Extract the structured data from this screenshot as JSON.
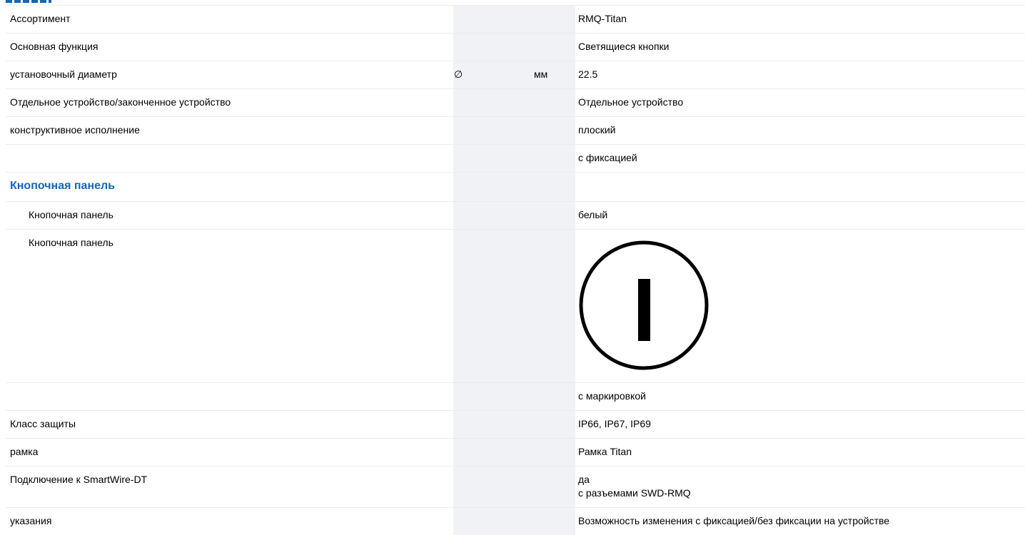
{
  "rows": {
    "assortment": {
      "label": "Ассортимент",
      "value": "RMQ-Titan"
    },
    "main_function": {
      "label": "Основная функция",
      "value": "Светящиеся кнопки"
    },
    "mount_diameter": {
      "label": "установочный диаметр",
      "symbol": "∅",
      "unit": "мм",
      "value": "22.5"
    },
    "single_device": {
      "label": "Отдельное устройство/законченное устройство",
      "value": "Отдельное устройство"
    },
    "design": {
      "label": "конструктивное исполнение",
      "value": "плоский"
    },
    "design_extra": {
      "value": "с фиксацией"
    },
    "button_panel_heading": {
      "label": "Кнопочная панель"
    },
    "button_panel_color": {
      "label": "Кнопочная панель",
      "value": "белый"
    },
    "button_panel_symbol": {
      "label": "Кнопочная панель",
      "icon": "power-on-symbol-icon"
    },
    "marking": {
      "value": "с маркировкой"
    },
    "protection": {
      "label": "Класс защиты",
      "value": "IP66, IP67, IP69"
    },
    "frame": {
      "label": "рамка",
      "value": "Рамка Titan"
    },
    "smartwire": {
      "label": "Подключение к SmartWire-DT",
      "value_line1": "да",
      "value_line2": "с разъемами SWD-RMQ"
    },
    "notes": {
      "label": "указания",
      "value": "Возможность изменения с фиксацией/без фиксации на устройстве"
    }
  },
  "colors": {
    "heading": "#1466b8",
    "shade": "#f0f2f5",
    "divider": "#e9ecef"
  }
}
